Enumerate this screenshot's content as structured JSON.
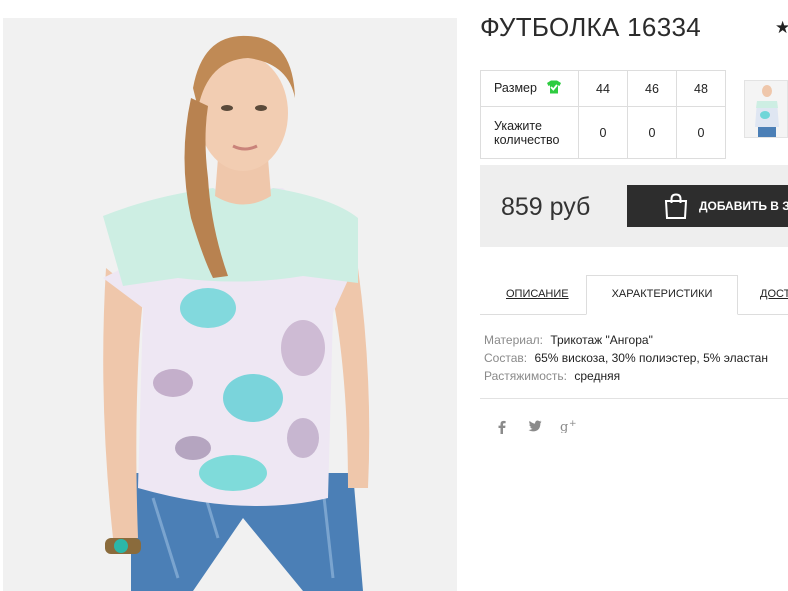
{
  "product": {
    "title": "ФУТБОЛКА 16334",
    "image_caption": "futbolka-16334"
  },
  "icons": {
    "star": "star-icon",
    "tshirt": "tshirt-check-icon",
    "bag": "shopping-bag-icon",
    "facebook": "facebook-icon",
    "twitter": "twitter-icon",
    "gplus": "google-plus-icon"
  },
  "star_glyph": "★",
  "sizes": {
    "label": "Размер",
    "qty_label": "Укажите количество",
    "values": [
      "44",
      "46",
      "48"
    ],
    "quantities": [
      "0",
      "0",
      "0"
    ]
  },
  "price": {
    "amount": "859 руб",
    "button_label": "ДОБАВИТЬ В ЗАКАЗ"
  },
  "tabs": [
    {
      "label": "ОПИСАНИЕ"
    },
    {
      "label": "ХАРАКТЕРИСТИКИ",
      "active": true
    },
    {
      "label": "ДОСТАВКА"
    }
  ],
  "specs": [
    {
      "key": "Материал:",
      "value": "Трикотаж \"Ангора\""
    },
    {
      "key": "Состав:",
      "value": "65% вискоза, 30% полиэстер, 5% эластан"
    },
    {
      "key": "Растяжимость:",
      "value": "средняя"
    }
  ],
  "social": {
    "facebook": "f",
    "twitter": "🐦",
    "gplus": "g+"
  },
  "colors": {
    "dark_button": "#2d2d2d",
    "price_bg": "#eeeeee",
    "check_green": "#2ecc40"
  }
}
